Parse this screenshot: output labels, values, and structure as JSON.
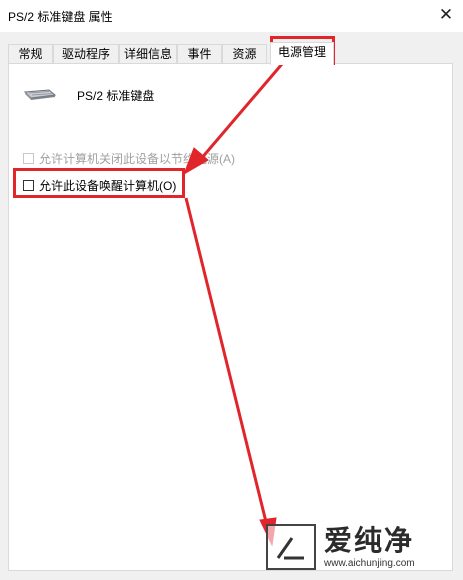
{
  "window": {
    "title": "PS/2 标准键盘 属性",
    "close_glyph": "✕"
  },
  "tabs": [
    {
      "label": "常规",
      "active": false
    },
    {
      "label": "驱动程序",
      "active": false
    },
    {
      "label": "详细信息",
      "active": false
    },
    {
      "label": "事件",
      "active": false
    },
    {
      "label": "资源",
      "active": false
    },
    {
      "label": "电源管理",
      "active": true
    }
  ],
  "device": {
    "name": "PS/2 标准键盘",
    "icon": "keyboard-icon"
  },
  "options": [
    {
      "label": "允许计算机关闭此设备以节约电源(A)",
      "checked": false,
      "enabled": false
    },
    {
      "label": "允许此设备唤醒计算机(O)",
      "checked": false,
      "enabled": true
    }
  ],
  "annotation": {
    "color": "#e0252b"
  },
  "watermark": {
    "name": "爱纯净",
    "url": "www.aichunjing.com"
  }
}
